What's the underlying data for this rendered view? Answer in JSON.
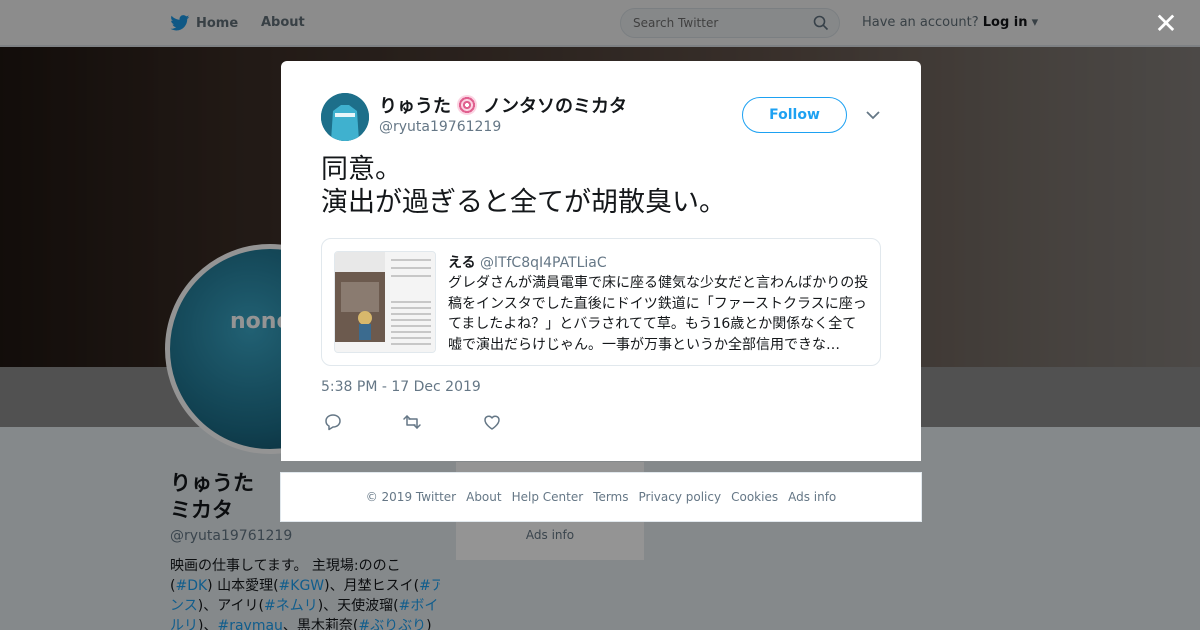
{
  "nav": {
    "home_label": "Home",
    "about_label": "About",
    "search_placeholder": "Search Twitter",
    "have_account": "Have an account?",
    "login_label": "Log in"
  },
  "profile": {
    "name_line1": "りゅうた",
    "name_line2": "ミカタ",
    "handle": "@ryuta19761219",
    "shirt_text": "none",
    "bio_lines": [
      [
        "映画の仕事してます。 主現場:ののこ"
      ],
      [
        "(",
        "#DK",
        ") 山本愛理(",
        "#KGW",
        ")、月埜ヒスイ(",
        "#ア"
      ],
      [
        "ンス",
        ")、アイリ(",
        "#ネムリ",
        ")、天使波瑠(",
        "#ボイ"
      ],
      [
        "ルリ",
        ")、",
        "#ravmau",
        "、黒木莉奈(",
        "#ぶりぶり",
        ")"
      ]
    ],
    "side_ads": "Ads info"
  },
  "tweet": {
    "name": "りゅうた",
    "name_suffix": "ノンタソのミカタ",
    "handle": "@ryuta19761219",
    "follow_label": "Follow",
    "text_line1": "同意。",
    "text_line2": "演出が過ぎると全てが胡散臭い。",
    "date": "5:38 PM - 17 Dec 2019",
    "quote": {
      "name": "える",
      "handle": "@lTfC8qI4PATLiaC",
      "lines": [
        "グレダさんが満員電車で床に座る健気な少女だと言わんばかりの投",
        "稿をインスタでした直後にドイツ鉄道に「ファーストクラスに座っ",
        "てましたよね？」とバラされてて草。もう16歳とか関係なく全て",
        "嘘で演出だらけじゃん。一事が万事というか全部信用できな…"
      ]
    }
  },
  "footer": {
    "copyright": "© 2019 Twitter",
    "about": "About",
    "help": "Help Center",
    "terms": "Terms",
    "privacy": "Privacy policy",
    "cookies": "Cookies",
    "ads": "Ads info"
  },
  "colors": {
    "twitter_blue": "#1da1f2",
    "secondary_text": "#657786",
    "primary_text": "#14171a"
  }
}
